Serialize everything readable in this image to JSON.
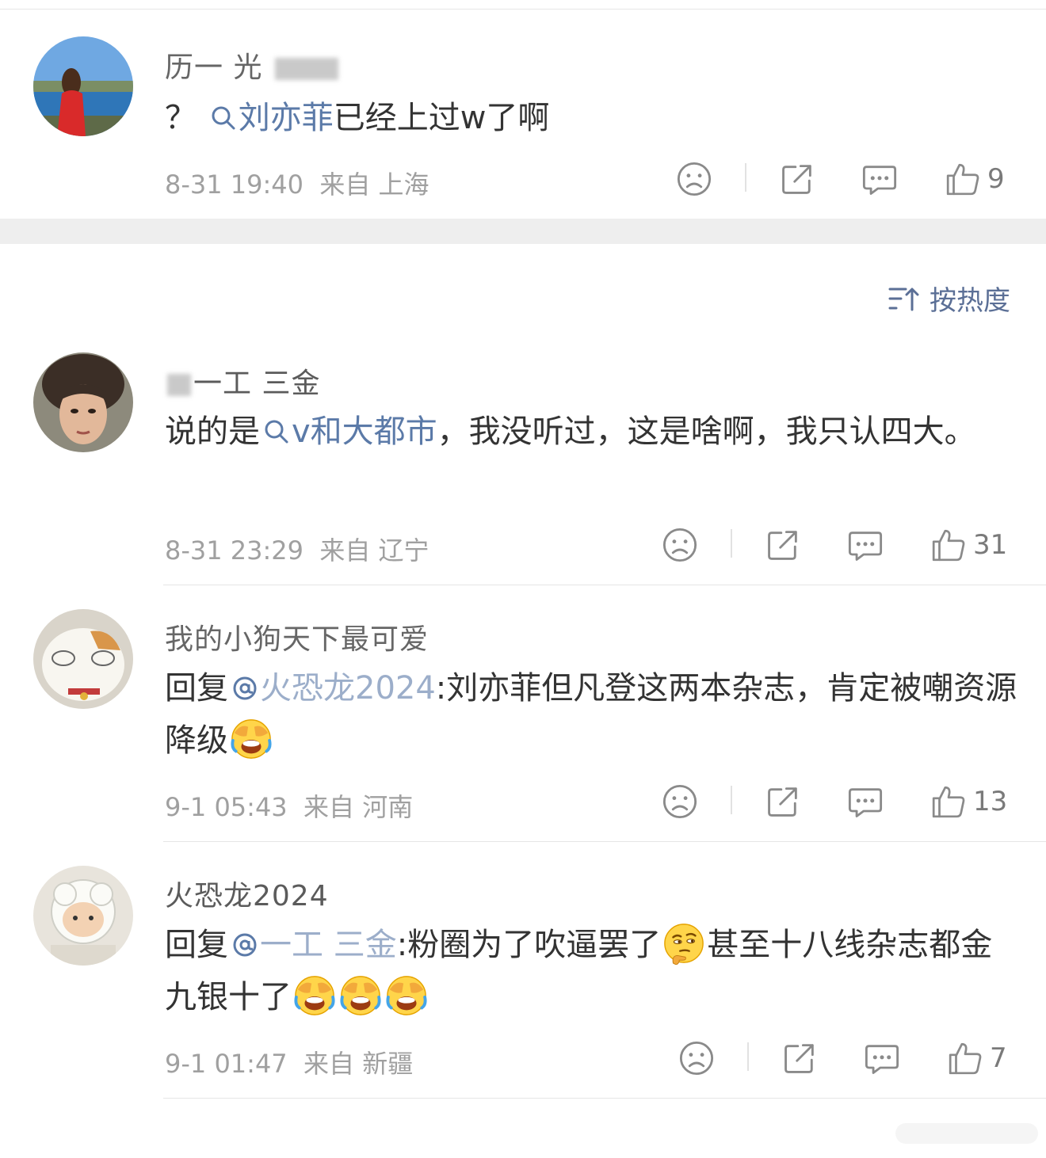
{
  "sort": {
    "label": "按热度"
  },
  "comments": [
    {
      "username_visible": "历一 光",
      "content_prefix": "？",
      "content_link": "刘亦菲",
      "content_suffix": "已经上过w了啊",
      "time": "8-31 19:40",
      "from": "来自",
      "location": "上海",
      "likes": "9"
    },
    {
      "username_visible": "一工 三金",
      "content_prefix": "说的是",
      "content_link": "v和大都市",
      "content_suffix": "，我没听过，这是啥啊，我只认四大。",
      "time": "8-31 23:29",
      "from": "来自",
      "location": "辽宁",
      "likes": "31"
    },
    {
      "username_visible": "我的小狗天下最可爱",
      "reply_label": "回复",
      "reply_target": "火恐龙2024",
      "content_suffix": ":刘亦菲但凡登这两本杂志，肯定被嘲资源降级",
      "time": "9-1 05:43",
      "from": "来自",
      "location": "河南",
      "likes": "13"
    },
    {
      "username_visible": "火恐龙2024",
      "reply_label": "回复",
      "reply_target": "一工 三金",
      "content_part1": ":粉圈为了吹逼罢了",
      "content_part2": "甚至十八线杂志都金九银十了",
      "time": "9-1 01:47",
      "from": "来自",
      "location": "新疆",
      "likes": "7"
    }
  ],
  "icons": {
    "dislike": "frown-face-icon",
    "share": "share-icon",
    "comment": "comment-bubble-icon",
    "like": "thumbs-up-icon",
    "search": "search-icon",
    "mention": "at-icon",
    "sort": "sort-icon",
    "emoji_laugh": "facepalm-laugh-emoji",
    "emoji_think": "thinking-face-emoji"
  },
  "colors": {
    "link": "#5b7aa8",
    "meta": "#a0a0a0",
    "text": "#333333",
    "band": "#eeeeee"
  }
}
